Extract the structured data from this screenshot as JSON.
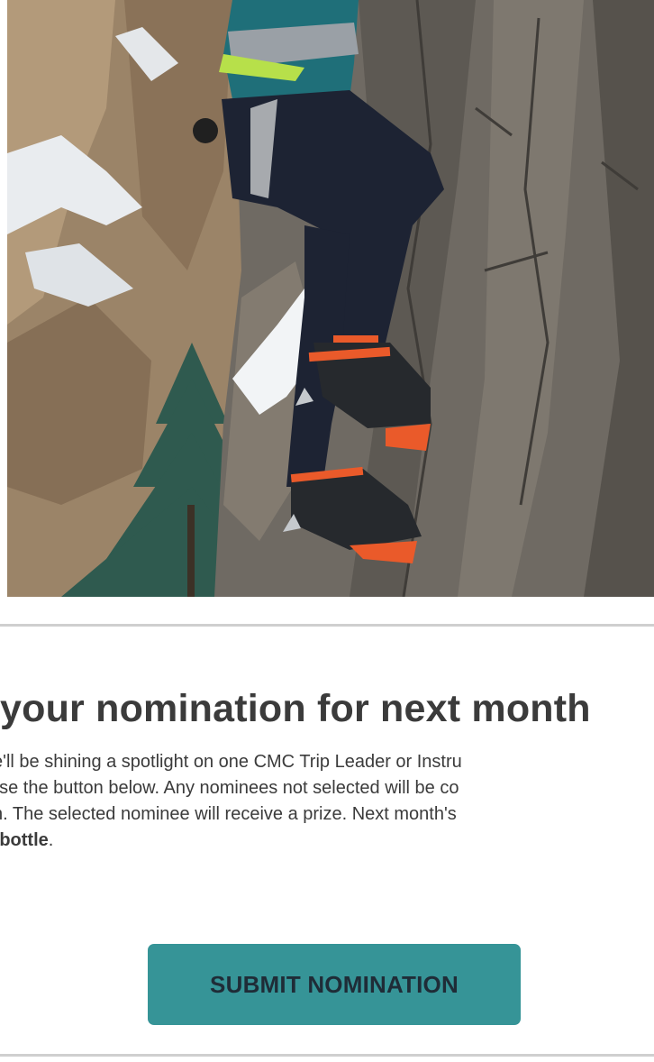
{
  "hero": {
    "alt": "Climber on rock face wearing crampons and harness",
    "colors": {
      "rock": "#6d665e",
      "pants": "#1d2333",
      "jacket": "#1f6f79",
      "crampon_strap": "#ea5a2a",
      "snow": "#f2f4f6",
      "tree": "#2f5a4f"
    }
  },
  "nomination": {
    "headline": "your nomination for next month",
    "body_lines": [
      "e'll be shining a spotlight on one CMC Trip Leader or Instru",
      "use the button below. Any nominees not selected will be co",
      "n. The selected nominee will receive a prize. Next month's"
    ],
    "prize_bold": "r bottle",
    "prize_suffix": ".",
    "button_label": "SUBMIT NOMINATION"
  },
  "theme": {
    "accent": "#369497",
    "text": "#3b3b3b",
    "divider": "#cfcfcf"
  }
}
